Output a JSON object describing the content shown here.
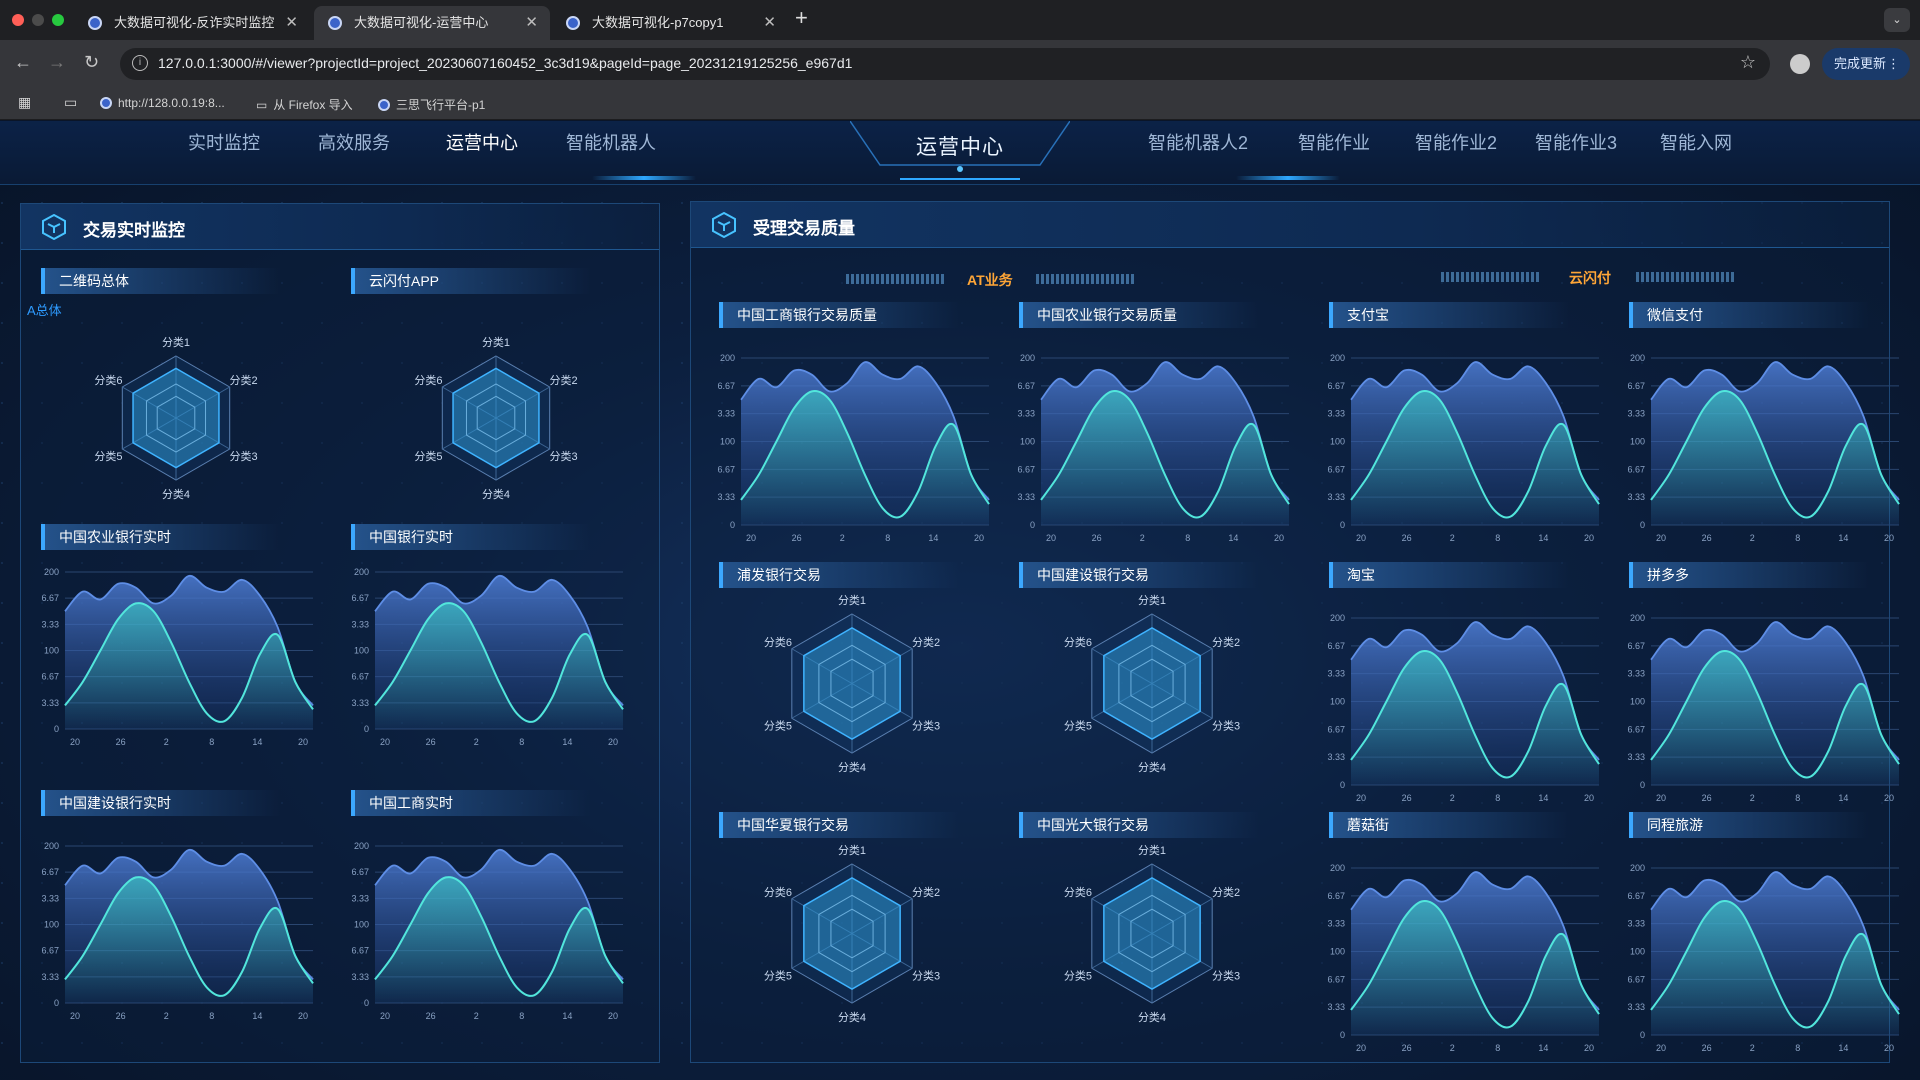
{
  "browser": {
    "tabs": [
      {
        "title": "大数据可视化-反诈实时监控",
        "active": false
      },
      {
        "title": "大数据可视化-运营中心",
        "active": true
      },
      {
        "title": "大数据可视化-p7copy1",
        "active": false
      }
    ],
    "url": "127.0.0.1:3000/#/viewer?projectId=project_20230607160452_3c3d19&pageId=page_20231219125256_e967d1",
    "update_button": "完成更新",
    "bookmarks": [
      "http://128.0.0.19:8...",
      "从 Firefox 导入",
      "三思飞行平台-p1"
    ]
  },
  "nav": {
    "center_title": "运营中心",
    "left_items": [
      "实时监控",
      "高效服务",
      "运营中心",
      "智能机器人"
    ],
    "right_items": [
      "智能机器人2",
      "智能作业",
      "智能作业2",
      "智能作业3",
      "智能入网"
    ],
    "active": "运营中心"
  },
  "left_panel": {
    "title": "交易实时监控",
    "radar_charts": [
      {
        "title": "二维码总体",
        "note": "A总体"
      },
      {
        "title": "云闪付APP",
        "note": ""
      }
    ],
    "line_charts": [
      "中国农业银行实时",
      "中国银行实时",
      "中国建设银行实时",
      "中国工商实时"
    ]
  },
  "right_panel": {
    "title": "受理交易质量",
    "segments": [
      "AT业务",
      "云闪付"
    ],
    "charts": [
      {
        "title": "中国工商银行交易质量",
        "type": "area"
      },
      {
        "title": "中国农业银行交易质量",
        "type": "area"
      },
      {
        "title": "支付宝",
        "type": "area"
      },
      {
        "title": "微信支付",
        "type": "area"
      },
      {
        "title": "浦发银行交易",
        "type": "radar"
      },
      {
        "title": "中国建设银行交易",
        "type": "radar"
      },
      {
        "title": "淘宝",
        "type": "area"
      },
      {
        "title": "拼多多",
        "type": "area"
      },
      {
        "title": "中国华夏银行交易",
        "type": "radar"
      },
      {
        "title": "中国光大银行交易",
        "type": "radar"
      },
      {
        "title": "蘑菇街",
        "type": "area"
      },
      {
        "title": "同程旅游",
        "type": "area"
      }
    ]
  },
  "chart_data": [
    {
      "type": "area",
      "x": [
        "20",
        "26",
        "2",
        "8",
        "14",
        "20"
      ],
      "y_ticks": [
        "0",
        "3.33",
        "6.67",
        "100",
        "3.33",
        "6.67",
        "200"
      ],
      "ylim": [
        0,
        200
      ],
      "series": [
        {
          "values": [
            150,
            175,
            165,
            185,
            180,
            160,
            170,
            195,
            180,
            175,
            190,
            170,
            130,
            60,
            30
          ]
        },
        {
          "values": [
            30,
            60,
            100,
            140,
            160,
            150,
            110,
            60,
            20,
            10,
            40,
            95,
            120,
            60,
            25
          ]
        }
      ]
    },
    {
      "type": "radar",
      "categories": [
        "分类1",
        "分类2",
        "分类3",
        "分类4",
        "分类5",
        "分类6"
      ],
      "values": [
        80,
        80,
        80,
        80,
        80,
        80
      ],
      "max": 100
    }
  ]
}
